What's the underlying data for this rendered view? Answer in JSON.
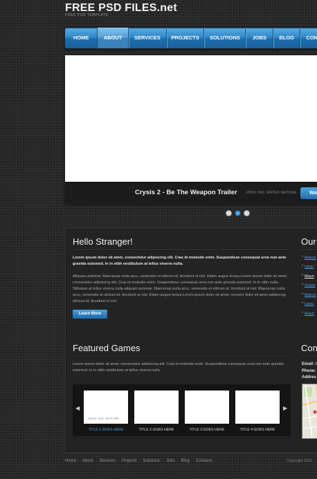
{
  "header": {
    "site_title": "FREE PSD FILES.net",
    "tagline": "FREE PSD TEMPLATE"
  },
  "nav": {
    "items": [
      {
        "label": "HOME"
      },
      {
        "label": "ABOUT",
        "active": true
      },
      {
        "label": "SERVICES"
      },
      {
        "label": "PROJECTS"
      },
      {
        "label": "SOLUTIONS"
      },
      {
        "label": "JOBS"
      },
      {
        "label": "BLOG"
      },
      {
        "label": "CON"
      }
    ]
  },
  "slider": {
    "caption_title": "Crysis 2 - Be The Weapon Trailer",
    "caption_meta": "XBOX 360, RATED MATURE",
    "watch_label": "Wat",
    "active_dot": 2
  },
  "welcome": {
    "title": "Hello Stranger!",
    "intro": "Lorem ipsum dolor sit amet, consectetur adipiscing elit. Cras id molestie enim. Suspendisse consequat urna non ante gravida euismod. In in nibh vestibulum at tellus viverra nulla.",
    "body": "Aliquam pulvinar. Maecenas nulla arcu, venenatis et ultrices id, tincidunt ut nisl. Etiam augue lectus,Lorem ipsum dolor sit amet, consectetur adipiscing elit. Cras id molestie enim. Suspendisse consequat urna non ante gravida euismod. In in nibh nulla. Stibulum at tellus viverra nulla aliquam pulvinar. Maecenas nulla arcu, venenatis et ultrices id, tincidunt ut nisl. Maecenas nulla arcu, venenatis et ultrices id, tincidunt ut nisl. Etiam augue lectus,Lorem ipsum dolor sit amet, consect dolor sit amet adipiscing ultrices id, tincidunt ut nisl.",
    "button_label": "Learn More"
  },
  "featured": {
    "title": "Featured Games",
    "description": "Lorem ipsum dolor sit amet, consectetur adipiscing elit. Cras id molestie enim. Suspendisse consequat urna non ante gravida euismod. In in nibh vestibulum at tellus viverra nulla.",
    "thumb_meta": "XBOX 360, MATURE",
    "items": [
      {
        "label": "TITLE 1 GOES HERE",
        "active": true
      },
      {
        "label": "TITLE 2 GOES HERE"
      },
      {
        "label": "TITLE 3 GOES HERE"
      },
      {
        "label": "TITLE 4 GOES HERE"
      }
    ]
  },
  "sidebar": {
    "title": "Our",
    "links": [
      "Maece",
      "Lipsu",
      "Mauri",
      "Suspe",
      "Maece",
      "Lipsu",
      "Mauri"
    ],
    "contact_title": "Con",
    "contact_lines": [
      "Email: i",
      "Phone:",
      "Addres"
    ]
  },
  "footer": {
    "links": [
      "Home",
      "About",
      "Services",
      "Projects",
      "Solutions",
      "Jobs",
      "Blog",
      "Contacts"
    ],
    "copyright": "Copyright 2011"
  },
  "colors": {
    "accent": "#2f86c6",
    "link": "#4da3e6",
    "background": "#2c2c2c"
  }
}
